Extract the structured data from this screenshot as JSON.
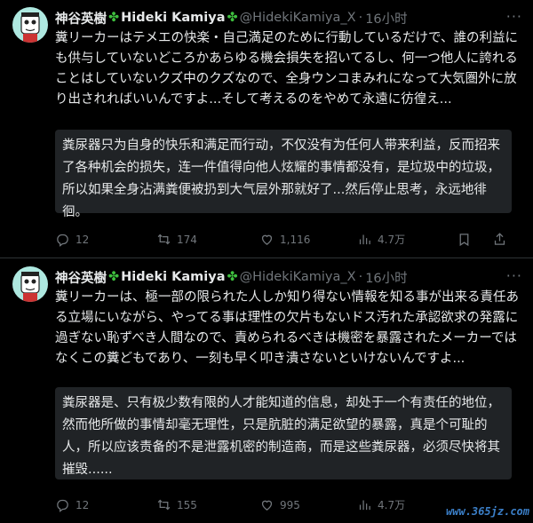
{
  "tweets": [
    {
      "display_name": "神谷英樹",
      "english_name": "Hideki Kamiya",
      "handle": "@HidekiKamiya_X",
      "time": "16小时",
      "body": "糞リーカーはテメエの快楽・自己満足のために行動しているだけで、誰の利益にも供与していないどころかあらゆる機会損失を招いてるし、何一つ他人に誇れることはしていないクズ中のクズなので、全身ウンコまみれになって大気圏外に放り出されればいいんですよ...そして考えるのをやめて永遠に彷徨え...",
      "translation": "粪尿器只为自身的快乐和满足而行动，不仅没有为任何人带来利益，反而招来了各种机会的损失，连一件值得向他人炫耀的事情都没有，是垃圾中的垃圾，所以如果全身沾满粪便被扔到大气层外那就好了...然后停止思考，永远地徘徊。",
      "replies": "12",
      "retweets": "174",
      "likes": "1,116",
      "views": "4.7万"
    },
    {
      "display_name": "神谷英樹",
      "english_name": "Hideki Kamiya",
      "handle": "@HidekiKamiya_X",
      "time": "16小时",
      "body": "糞リーカーは、極一部の限られた人しか知り得ない情報を知る事が出来る責任ある立場にいながら、やってる事は理性の欠片もないドス汚れた承認欲求の発露に過ぎない恥ずべき人間なので、責められるべきは機密を暴露されたメーカーではなくこの糞どもであり、一刻も早く叩き潰さないといけないんですよ...",
      "translation": "粪尿器是、只有极少数有限的人才能知道的信息，却处于一个有责任的地位，然而他所做的事情却毫无理性，只是肮脏的满足欲望的暴露，真是个可耻的人，所以应该责备的不是泄露机密的制造商，而是这些粪尿器，必须尽快将其摧毁......",
      "replies": "12",
      "retweets": "155",
      "likes": "995",
      "views": "4.7万"
    }
  ],
  "icons": {
    "reply": "reply-icon",
    "retweet": "retweet-icon",
    "like": "like-icon",
    "views": "views-icon",
    "bookmark": "bookmark-icon",
    "share": "share-icon",
    "more": "more-icon",
    "clover": "clover-icon"
  },
  "clover_glyph": "✤",
  "more_glyph": "···",
  "watermark": "www.365jz.com",
  "colors": {
    "background": "#000000",
    "text": "#e7e9ea",
    "muted": "#71767b",
    "translation_bg": "#202326",
    "clover": "#3fbf3f",
    "avatar_bg": "#aee8e0"
  }
}
